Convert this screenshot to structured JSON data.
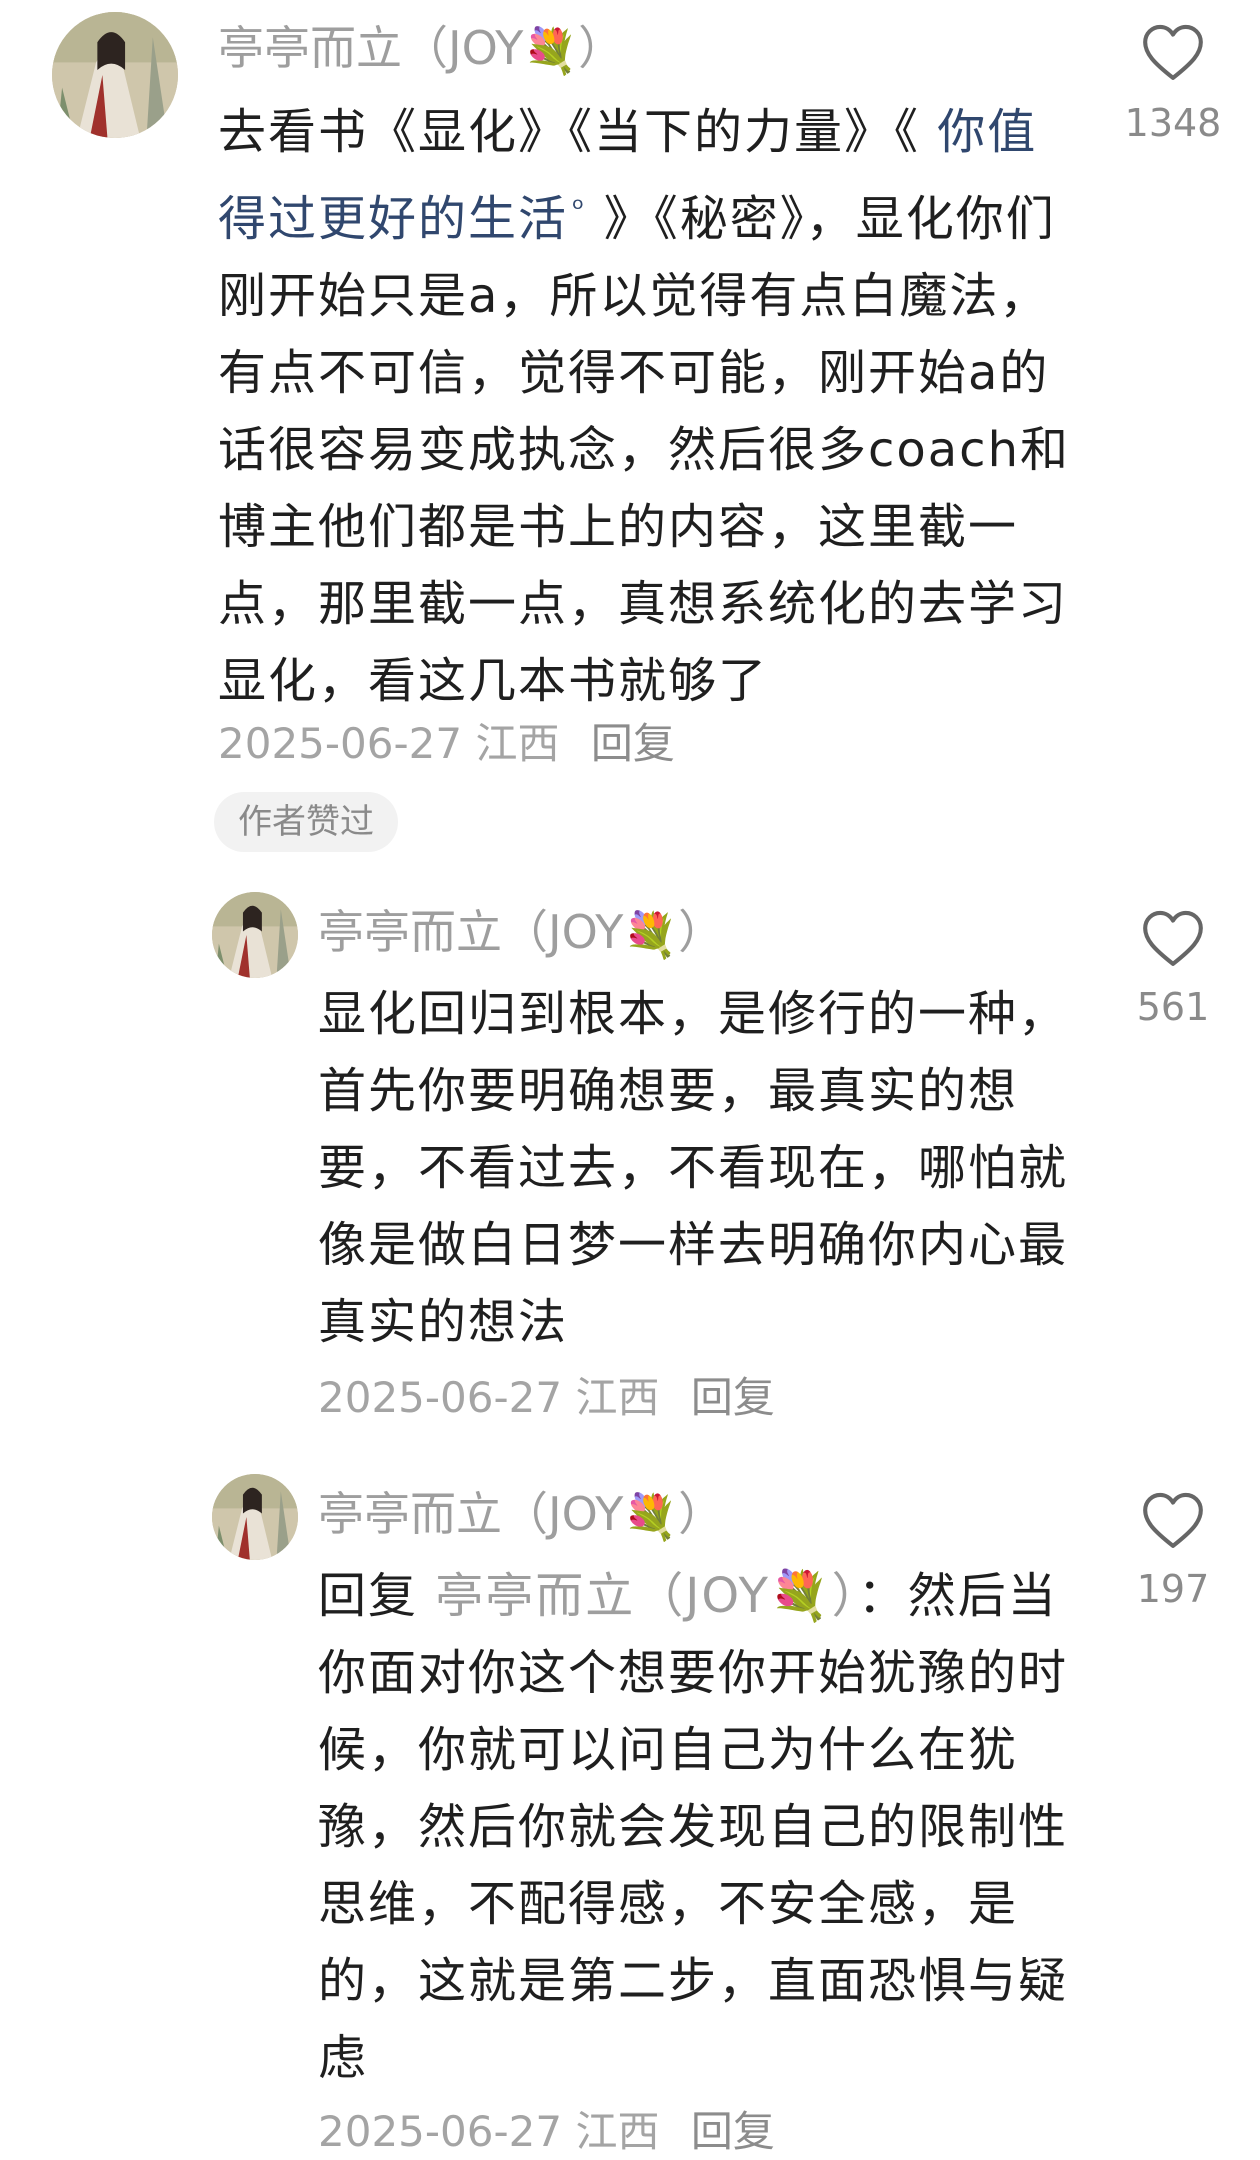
{
  "comments": [
    {
      "author": "亭亭而立（JOY",
      "author_suffix": "）",
      "flower": "💐",
      "text_before_link": "去看书《显化》《当下的力量》《 ",
      "link_text": "你值得过更好的生活",
      "link_mark": "ᵒ",
      "text_after_link": " 》《秘密》，显化你们刚开始只是a，所以觉得有点白魔法，有点不可信，觉得不可能，刚开始a的话很容易变成执念，然后很多coach和博主他们都是书上的内容，这里截一点，那里截一点，真想系统化的去学习显化，看这几本书就够了",
      "date": "2025-06-27",
      "location": "江西",
      "reply_label": "回复",
      "badge": "作者赞过",
      "likes": "1348"
    },
    {
      "author": "亭亭而立（JOY",
      "author_suffix": "）",
      "flower": "💐",
      "text": "显化回归到根本，是修行的一种，首先你要明确想要，最真实的想要，不看过去，不看现在，哪怕就像是做白日梦一样去明确你内心最真实的想法",
      "date": "2025-06-27",
      "location": "江西",
      "reply_label": "回复",
      "likes": "561"
    },
    {
      "author": "亭亭而立（JOY",
      "author_suffix": "）",
      "flower": "💐",
      "reply_prefix": "回复 ",
      "reply_target": "亭亭而立（JOY",
      "reply_target_suffix": "）",
      "reply_colon": "：",
      "text": "然后当你面对你这个想要你开始犹豫的时候，你就可以问自己为什么在犹豫，然后你就会发现自己的限制性思维，不配得感，不安全感，是的，这就是第二步，直面恐惧与疑虑",
      "date": "2025-06-27",
      "location": "江西",
      "reply_label": "回复",
      "likes": "197"
    }
  ],
  "icons": {
    "like": "heart-outline-icon",
    "avatar": "portrait-painting-avatar"
  },
  "colors": {
    "name": "#9e9e9e",
    "link": "#30476e",
    "meta": "#a4a4a4",
    "badge_bg": "#f2f2f2"
  }
}
